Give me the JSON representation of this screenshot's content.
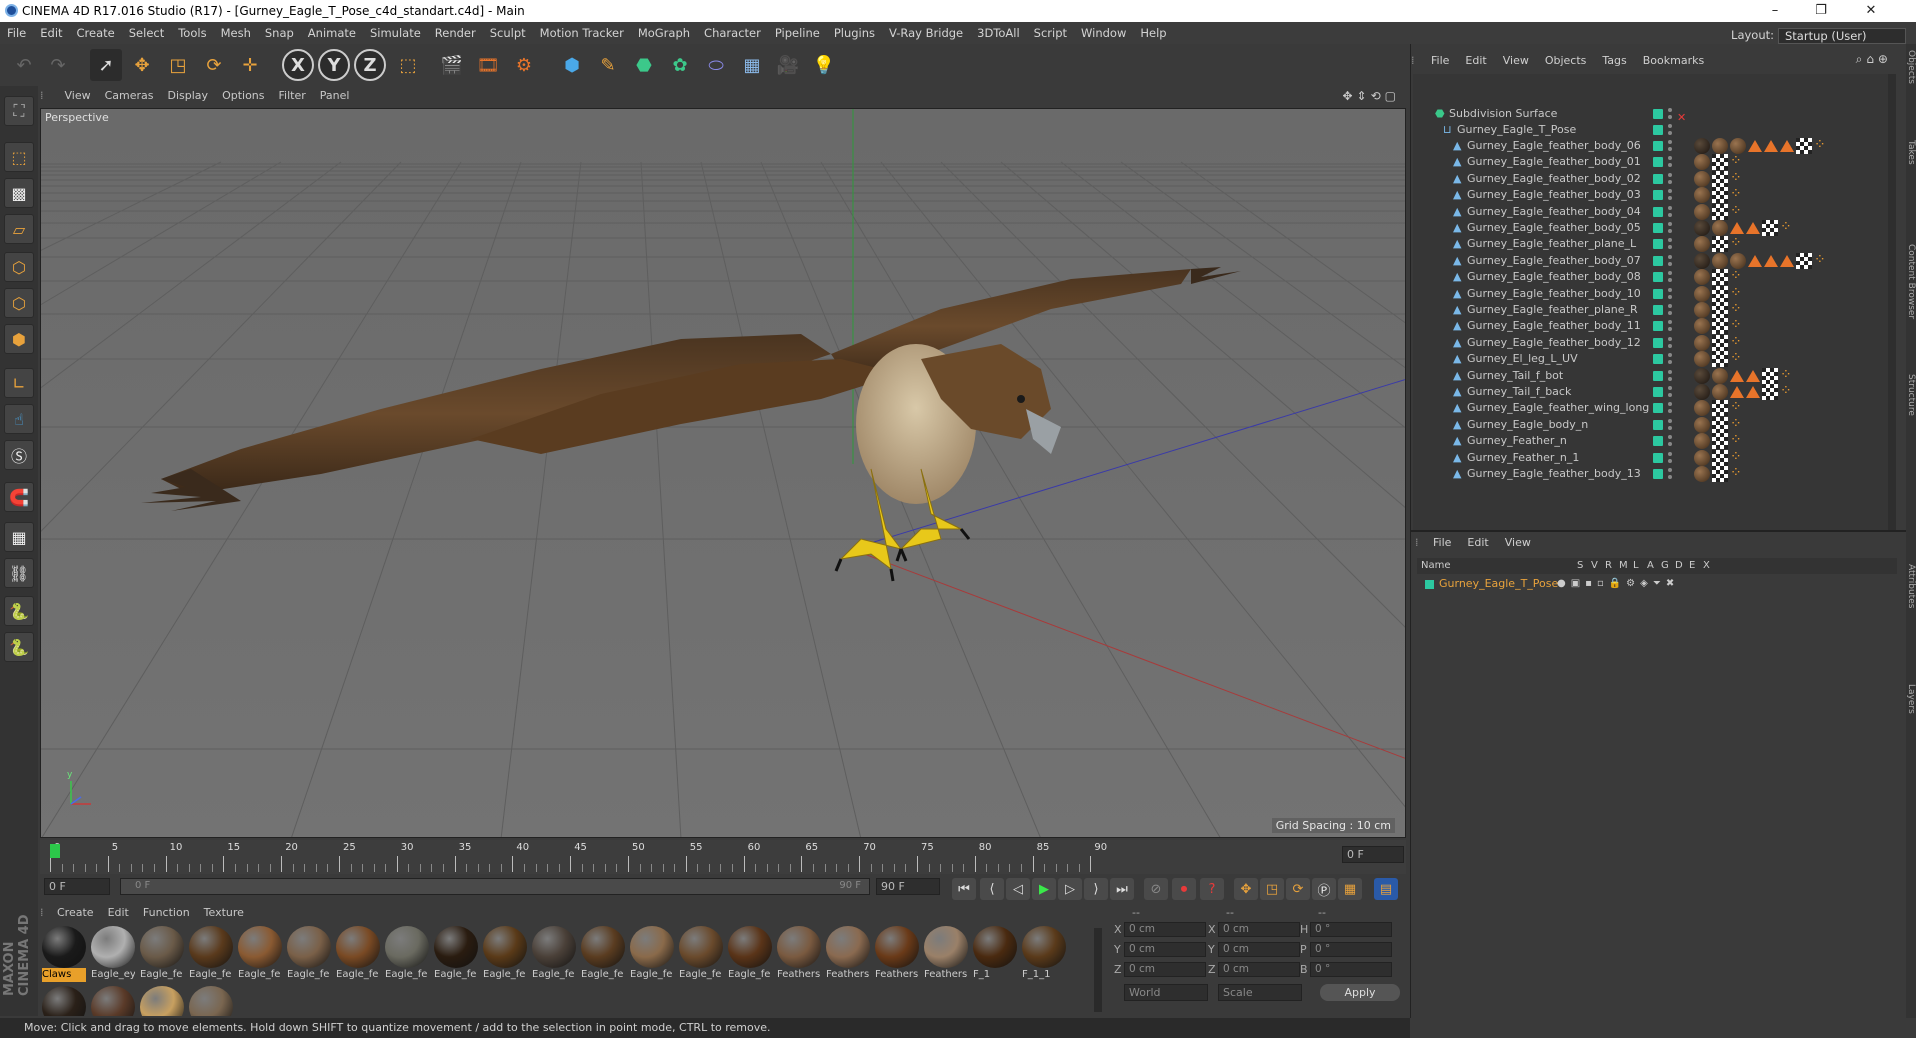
{
  "window": {
    "title": "CINEMA 4D R17.016 Studio (R17) - [Gurney_Eagle_T_Pose_c4d_standart.c4d] - Main",
    "controls": [
      "–",
      "❐",
      "✕"
    ]
  },
  "menubar": {
    "items": [
      "File",
      "Edit",
      "Create",
      "Select",
      "Tools",
      "Mesh",
      "Snap",
      "Animate",
      "Simulate",
      "Render",
      "Sculpt",
      "Motion Tracker",
      "MoGraph",
      "Character",
      "Pipeline",
      "Plugins",
      "V-Ray Bridge",
      "3DToAll",
      "Script",
      "Window",
      "Help"
    ],
    "layout_label": "Layout:",
    "layout_value": "Startup (User)"
  },
  "toolbar": {
    "axis_x": "X",
    "axis_y": "Y",
    "axis_z": "Z"
  },
  "viewport": {
    "menu": [
      "View",
      "Cameras",
      "Display",
      "Options",
      "Filter",
      "Panel"
    ],
    "label": "Perspective",
    "grid_spacing": "Grid Spacing : 10 cm"
  },
  "timeline": {
    "ticks": [
      "0",
      "5",
      "10",
      "15",
      "20",
      "25",
      "30",
      "35",
      "40",
      "45",
      "50",
      "55",
      "60",
      "65",
      "70",
      "75",
      "80",
      "85",
      "90"
    ],
    "current_frame": "0 F",
    "start_field": "0 F",
    "range_start": "0 F",
    "range_end": "90 F",
    "end_field": "90 F"
  },
  "materials": {
    "menu": [
      "Create",
      "Edit",
      "Function",
      "Texture"
    ],
    "items": [
      {
        "label": "Claws",
        "color": "#1a1a1a",
        "selected": true
      },
      {
        "label": "Eagle_ey",
        "color": "#b0b0b0"
      },
      {
        "label": "Eagle_fe",
        "color": "#6a5a48"
      },
      {
        "label": "Eagle_fe",
        "color": "#5a3a1c"
      },
      {
        "label": "Eagle_fe",
        "color": "#8a5a32"
      },
      {
        "label": "Eagle_fe",
        "color": "#7a6048"
      },
      {
        "label": "Eagle_fe",
        "color": "#7a4a24"
      },
      {
        "label": "Eagle_fe",
        "color": "#6a6a60"
      },
      {
        "label": "Eagle_fe",
        "color": "#2a1c10"
      },
      {
        "label": "Eagle_fe",
        "color": "#5a3a18"
      },
      {
        "label": "Eagle_fe",
        "color": "#4a4038"
      },
      {
        "label": "Eagle_fe",
        "color": "#5a3c20"
      },
      {
        "label": "Eagle_fe",
        "color": "#8a6a4a"
      },
      {
        "label": "Eagle_fe",
        "color": "#6a4a2c"
      },
      {
        "label": "Eagle_fe",
        "color": "#5a3418"
      },
      {
        "label": "Feathers",
        "color": "#7a5a40"
      },
      {
        "label": "Feathers",
        "color": "#8a6a50"
      },
      {
        "label": "Feathers",
        "color": "#6a3a18"
      },
      {
        "label": "Feathers",
        "color": "#9a8068"
      },
      {
        "label": "F_1",
        "color": "#4a2a10"
      },
      {
        "label": "F_1_1",
        "color": "#5a3a1a"
      }
    ],
    "row2_colors": [
      "#2a2018",
      "#5a3a28",
      "#c8a060",
      "#7a6650"
    ]
  },
  "coords": {
    "headers": [
      "--",
      "--",
      "--"
    ],
    "rows": [
      {
        "l1": "X",
        "v1": "0 cm",
        "l2": "X",
        "v2": "0 cm",
        "l3": "H",
        "v3": "0 °"
      },
      {
        "l1": "Y",
        "v1": "0 cm",
        "l2": "Y",
        "v2": "0 cm",
        "l3": "P",
        "v3": "0 °"
      },
      {
        "l1": "Z",
        "v1": "0 cm",
        "l2": "Z",
        "v2": "0 cm",
        "l3": "B",
        "v3": "0 °"
      }
    ],
    "mode": "World",
    "scale": "Scale",
    "apply": "Apply"
  },
  "objects": {
    "menu": [
      "File",
      "Edit",
      "View",
      "Objects",
      "Tags",
      "Bookmarks"
    ],
    "root": "Subdivision Surface",
    "group": "Gurney_Eagle_T_Pose",
    "items": [
      {
        "name": "Gurney_Eagle_feather_body_06",
        "tags": "long"
      },
      {
        "name": "Gurney_Eagle_feather_body_01",
        "tags": "short"
      },
      {
        "name": "Gurney_Eagle_feather_body_02",
        "tags": "short"
      },
      {
        "name": "Gurney_Eagle_feather_body_03",
        "tags": "short"
      },
      {
        "name": "Gurney_Eagle_feather_body_04",
        "tags": "short"
      },
      {
        "name": "Gurney_Eagle_feather_body_05",
        "tags": "mid"
      },
      {
        "name": "Gurney_Eagle_feather_plane_L",
        "tags": "short"
      },
      {
        "name": "Gurney_Eagle_feather_body_07",
        "tags": "long"
      },
      {
        "name": "Gurney_Eagle_feather_body_08",
        "tags": "short"
      },
      {
        "name": "Gurney_Eagle_feather_body_10",
        "tags": "short"
      },
      {
        "name": "Gurney_Eagle_feather_plane_R",
        "tags": "short"
      },
      {
        "name": "Gurney_Eagle_feather_body_11",
        "tags": "short"
      },
      {
        "name": "Gurney_Eagle_feather_body_12",
        "tags": "short"
      },
      {
        "name": "Gurney_El_leg_L_UV",
        "tags": "short"
      },
      {
        "name": "Gurney_Tail_f_bot",
        "tags": "mid"
      },
      {
        "name": "Gurney_Tail_f_back",
        "tags": "mid"
      },
      {
        "name": "Gurney_Eagle_feather_wing_long",
        "tags": "short"
      },
      {
        "name": "Gurney_Eagle_body_n",
        "tags": "short"
      },
      {
        "name": "Gurney_Feather_n",
        "tags": "short"
      },
      {
        "name": "Gurney_Feather_n_1",
        "tags": "short"
      },
      {
        "name": "Gurney_Eagle_feather_body_13",
        "tags": "short"
      }
    ]
  },
  "layers": {
    "menu": [
      "File",
      "Edit",
      "View"
    ],
    "columns": [
      "Name",
      "S",
      "V",
      "R",
      "M",
      "L",
      "A",
      "G",
      "D",
      "E",
      "X"
    ],
    "row_name": "Gurney_Eagle_T_Pose"
  },
  "side_tabs": [
    "Objects",
    "Takes",
    "Content Browser",
    "Structure",
    "Attributes",
    "Layers"
  ],
  "status": "Move: Click and drag to move elements. Hold down SHIFT to quantize movement / add to the selection in point mode, CTRL to remove.",
  "brand": "MAXON CINEMA 4D"
}
